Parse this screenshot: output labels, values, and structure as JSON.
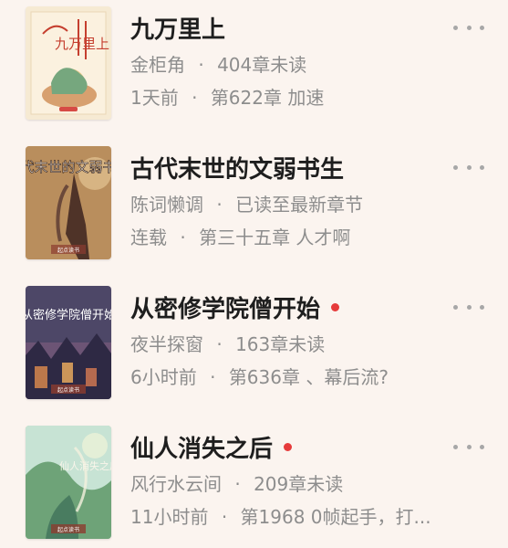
{
  "books": [
    {
      "title": "九万里上",
      "author": "金柜角",
      "status": "404章未读",
      "updated": "1天前",
      "chapter": "第622章 加速",
      "has_dot": false,
      "cover_title": "九万里上",
      "cover_badge": ""
    },
    {
      "title": "古代末世的文弱书生",
      "author": "陈词懒调",
      "status": "已读至最新章节",
      "updated": "连载",
      "chapter": "第三十五章 人才啊",
      "has_dot": false,
      "cover_title": "古代末世的文弱书生",
      "cover_badge": "起点读书"
    },
    {
      "title": "从密修学院僧开始",
      "author": "夜半探窗",
      "status": "163章未读",
      "updated": "6小时前",
      "chapter": "第636章 、幕后流?",
      "has_dot": true,
      "cover_title": "从密修学院僧开始",
      "cover_badge": "起点读书"
    },
    {
      "title": "仙人消失之后",
      "author": "风行水云间",
      "status": "209章未读",
      "updated": "11小时前",
      "chapter": "第1968 0帧起手，打...",
      "has_dot": true,
      "cover_title": "仙人消失之后",
      "cover_badge": "起点读书"
    }
  ],
  "colors": {
    "background": "#fbf4ef",
    "title": "#1e1e1e",
    "meta": "#8d8d8d",
    "dot": "#e63b3b"
  }
}
